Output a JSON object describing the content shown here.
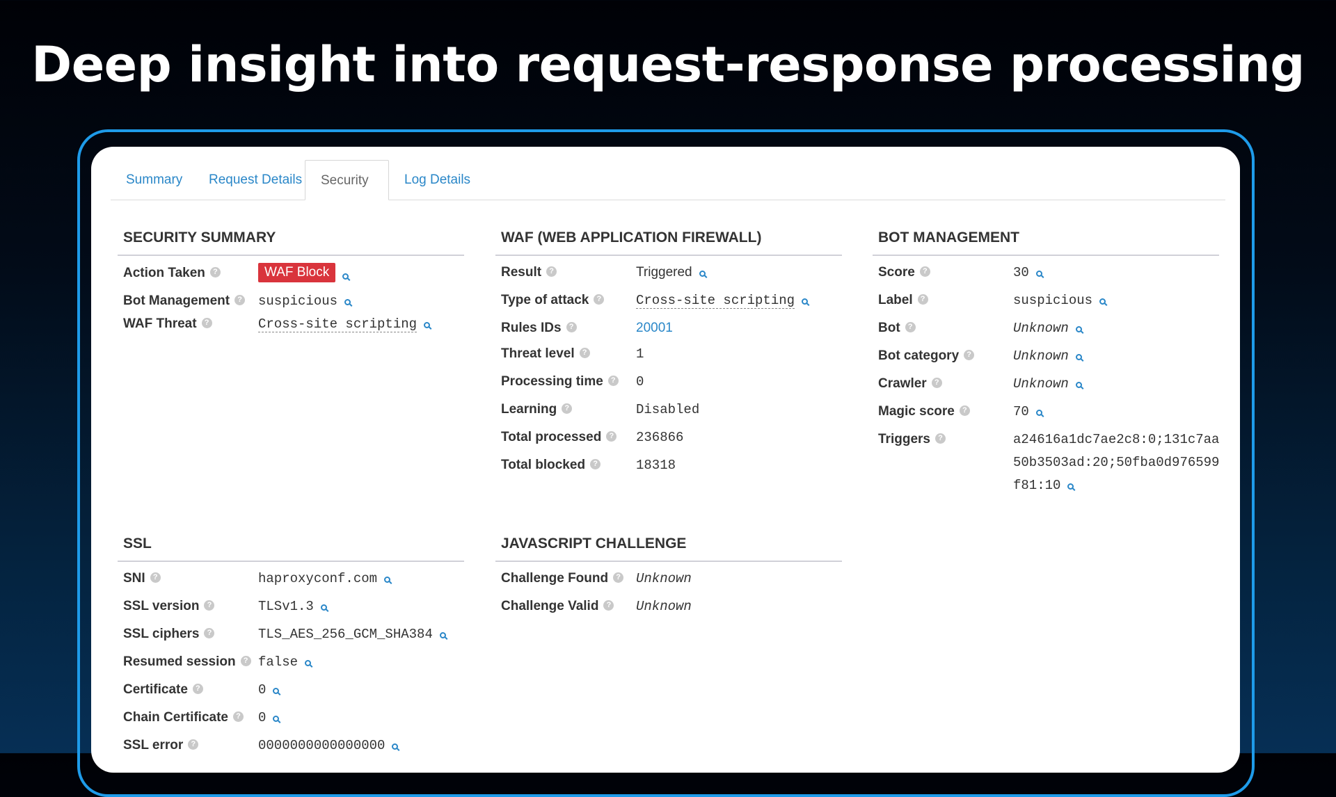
{
  "headline": "Deep insight into request-response processing",
  "colors": {
    "accent": "#1e9be9",
    "link": "#2a87c8",
    "badge": "#d9343c"
  },
  "icons": {
    "help": "question-mark-icon",
    "filter": "magnifier-icon"
  },
  "tabs": [
    {
      "label": "Summary"
    },
    {
      "label": "Request Details"
    },
    {
      "label": "Security"
    },
    {
      "label": "Log Details"
    }
  ],
  "active_tab": "Security",
  "security_summary": {
    "title": "SECURITY SUMMARY",
    "rows": [
      {
        "label": "Action Taken",
        "value": "WAF Block"
      },
      {
        "label": "Bot Management",
        "value": "suspicious"
      },
      {
        "label": "WAF Threat",
        "value": "Cross-site scripting"
      }
    ]
  },
  "waf": {
    "title": "WAF (WEB APPLICATION FIREWALL)",
    "rows": [
      {
        "label": "Result",
        "value": "Triggered"
      },
      {
        "label": "Type of attack",
        "value": "Cross-site scripting"
      },
      {
        "label": "Rules IDs",
        "value": "20001"
      },
      {
        "label": "Threat level",
        "value": "1"
      },
      {
        "label": "Processing time",
        "value": "0"
      },
      {
        "label": "Learning",
        "value": "Disabled"
      },
      {
        "label": "Total processed",
        "value": "236866"
      },
      {
        "label": "Total blocked",
        "value": "18318"
      }
    ]
  },
  "bot": {
    "title": "BOT MANAGEMENT",
    "rows": [
      {
        "label": "Score",
        "value": "30"
      },
      {
        "label": "Label",
        "value": "suspicious"
      },
      {
        "label": "Bot",
        "value": "Unknown"
      },
      {
        "label": "Bot category",
        "value": "Unknown"
      },
      {
        "label": "Crawler",
        "value": "Unknown"
      },
      {
        "label": "Magic score",
        "value": "70"
      },
      {
        "label": "Triggers",
        "value": "a24616a1dc7ae2c8:0;131c7aa50b3503ad:20;50fba0d976599f81:10"
      }
    ]
  },
  "ssl": {
    "title": "SSL",
    "rows": [
      {
        "label": "SNI",
        "value": "haproxyconf.com"
      },
      {
        "label": "SSL version",
        "value": "TLSv1.3"
      },
      {
        "label": "SSL ciphers",
        "value": "TLS_AES_256_GCM_SHA384"
      },
      {
        "label": "Resumed session",
        "value": "false"
      },
      {
        "label": "Certificate",
        "value": "0"
      },
      {
        "label": "Chain Certificate",
        "value": "0"
      },
      {
        "label": "SSL error",
        "value": "0000000000000000"
      }
    ]
  },
  "js_challenge": {
    "title": "JAVASCRIPT CHALLENGE",
    "rows": [
      {
        "label": "Challenge Found",
        "value": "Unknown"
      },
      {
        "label": "Challenge Valid",
        "value": "Unknown"
      }
    ]
  }
}
